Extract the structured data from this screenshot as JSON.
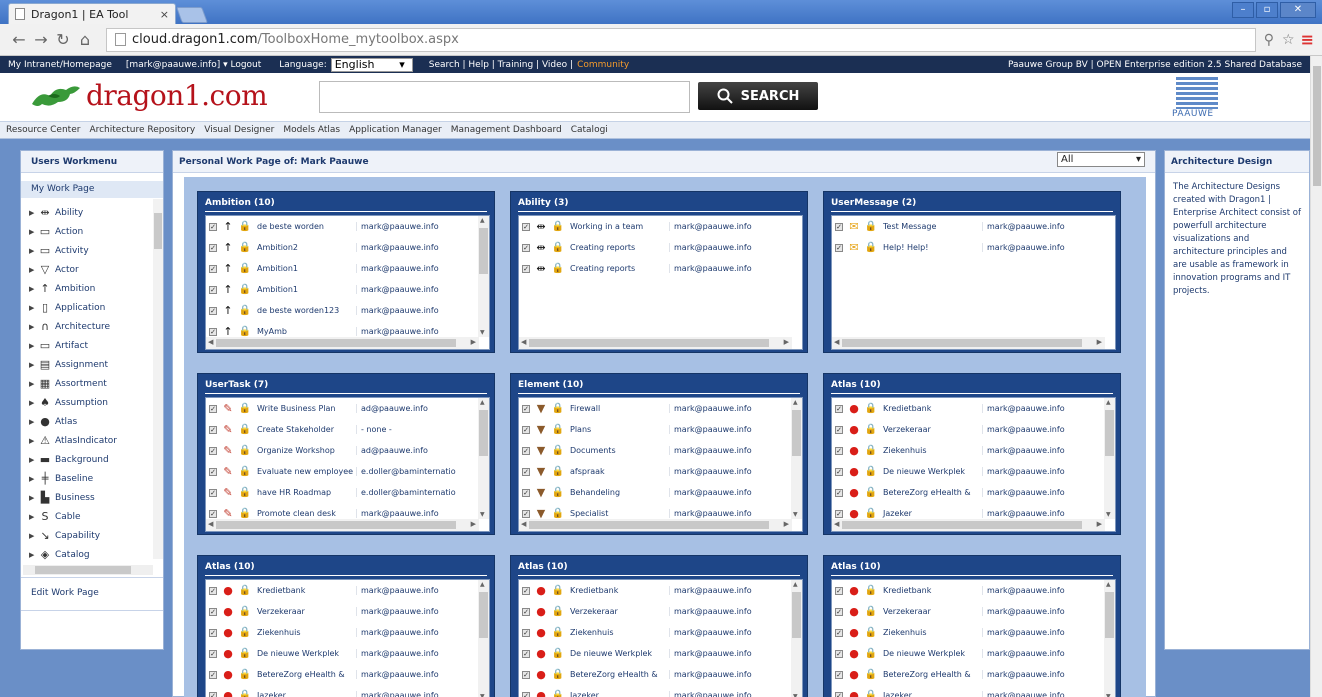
{
  "browser": {
    "tab_title": "Dragon1 | EA Tool",
    "tab_close": "×",
    "url_host": "cloud.dragon1.com",
    "url_path": "/ToolboxHome_mytoolbox.aspx"
  },
  "topbar": {
    "intranet": "My Intranet/Homepage",
    "user": "[mark@paauwe.info] ▾ Logout",
    "language_label": "Language:",
    "language_value": "English",
    "links": "Search | Help | Training | Video |",
    "community": "Community",
    "right": "Paauwe Group BV | OPEN   Enterprise edition   2.5   Shared Database"
  },
  "header": {
    "logo_text": "dragon1.com",
    "search_label": "SEARCH",
    "partner_logo": "PAAUWE"
  },
  "menu": [
    "Resource Center",
    "Architecture Repository",
    "Visual Designer",
    "Models Atlas",
    "Application Manager",
    "Management Dashboard",
    "Catalogi"
  ],
  "left": {
    "title": "Users Workmenu",
    "my_work_page": "My Work Page",
    "items": [
      {
        "label": "Ability",
        "icon": "ability-icon",
        "glyph": "⇹"
      },
      {
        "label": "Action",
        "icon": "action-icon",
        "glyph": "▭"
      },
      {
        "label": "Activity",
        "icon": "activity-icon",
        "glyph": "▭"
      },
      {
        "label": "Actor",
        "icon": "actor-icon",
        "glyph": "▽"
      },
      {
        "label": "Ambition",
        "icon": "ambition-icon",
        "glyph": "↑"
      },
      {
        "label": "Application",
        "icon": "application-icon",
        "glyph": "▯"
      },
      {
        "label": "Architecture",
        "icon": "architecture-icon",
        "glyph": "∩"
      },
      {
        "label": "Artifact",
        "icon": "artifact-icon",
        "glyph": "▭"
      },
      {
        "label": "Assignment",
        "icon": "assignment-icon",
        "glyph": "▤"
      },
      {
        "label": "Assortment",
        "icon": "assortment-icon",
        "glyph": "▦"
      },
      {
        "label": "Assumption",
        "icon": "assumption-icon",
        "glyph": "♠"
      },
      {
        "label": "Atlas",
        "icon": "atlas-icon",
        "glyph": "●"
      },
      {
        "label": "AtlasIndicator",
        "icon": "atlas-indicator-icon",
        "glyph": "⚠"
      },
      {
        "label": "Background",
        "icon": "background-icon",
        "glyph": "▬"
      },
      {
        "label": "Baseline",
        "icon": "baseline-icon",
        "glyph": "╪"
      },
      {
        "label": "Business",
        "icon": "business-icon",
        "glyph": "▙"
      },
      {
        "label": "Cable",
        "icon": "cable-icon",
        "glyph": "S"
      },
      {
        "label": "Capability",
        "icon": "capability-icon",
        "glyph": "↘"
      },
      {
        "label": "Catalog",
        "icon": "catalog-icon",
        "glyph": "◈"
      }
    ],
    "edit_work_page": "Edit Work Page"
  },
  "main": {
    "title": "Personal Work Page of: Mark Paauwe",
    "filter_value": "All",
    "boxes": [
      {
        "title": "Ambition (10)",
        "type_icon": "↑",
        "type_color": "#111",
        "rows": [
          {
            "name": "de beste worden",
            "owner": "mark@paauwe.info"
          },
          {
            "name": "Ambition2",
            "owner": "mark@paauwe.info"
          },
          {
            "name": "Ambition1",
            "owner": "mark@paauwe.info"
          },
          {
            "name": "Ambition1",
            "owner": "mark@paauwe.info"
          },
          {
            "name": "de beste worden123",
            "owner": "mark@paauwe.info"
          },
          {
            "name": "MyAmb",
            "owner": "mark@paauwe.info"
          }
        ]
      },
      {
        "title": "Ability (3)",
        "type_icon": "⇹",
        "type_color": "#111",
        "rows": [
          {
            "name": "Working in a team",
            "owner": "mark@paauwe.info"
          },
          {
            "name": "Creating reports",
            "owner": "mark@paauwe.info"
          },
          {
            "name": "Creating reports",
            "owner": "mark@paauwe.info"
          }
        ]
      },
      {
        "title": "UserMessage (2)",
        "type_icon": "✉",
        "type_color": "#e6a417",
        "rows": [
          {
            "name": "Test Message",
            "owner": "mark@paauwe.info"
          },
          {
            "name": "Help! Help!",
            "owner": "mark@paauwe.info"
          }
        ]
      },
      {
        "title": "UserTask (7)",
        "type_icon": "✎",
        "type_color": "#c0392b",
        "rows": [
          {
            "name": "Write Business Plan",
            "owner": "ad@paauwe.info"
          },
          {
            "name": "Create Stakeholder",
            "owner": "- none -"
          },
          {
            "name": "Organize Workshop",
            "owner": "ad@paauwe.info"
          },
          {
            "name": "Evaluate new employee",
            "owner": "e.doller@baminternatio"
          },
          {
            "name": "have HR Roadmap",
            "owner": "e.doller@baminternatio"
          },
          {
            "name": "Promote clean desk",
            "owner": "mark@paauwe.info"
          }
        ]
      },
      {
        "title": "Element (10)",
        "type_icon": "▼",
        "type_color": "#8b5a2b",
        "rows": [
          {
            "name": "Firewall",
            "owner": "mark@paauwe.info"
          },
          {
            "name": "Plans",
            "owner": "mark@paauwe.info"
          },
          {
            "name": "Documents",
            "owner": "mark@paauwe.info"
          },
          {
            "name": "afspraak",
            "owner": "mark@paauwe.info"
          },
          {
            "name": "Behandeling",
            "owner": "mark@paauwe.info"
          },
          {
            "name": "Specialist",
            "owner": "mark@paauwe.info"
          }
        ]
      },
      {
        "title": "Atlas (10)",
        "type_icon": "●",
        "type_color": "#d91e18",
        "rows": [
          {
            "name": "Kredietbank",
            "owner": "mark@paauwe.info"
          },
          {
            "name": "Verzekeraar",
            "owner": "mark@paauwe.info"
          },
          {
            "name": "Ziekenhuis",
            "owner": "mark@paauwe.info"
          },
          {
            "name": "De nieuwe Werkplek",
            "owner": "mark@paauwe.info"
          },
          {
            "name": "BetereZorg eHealth &",
            "owner": "mark@paauwe.info"
          },
          {
            "name": "Jazeker",
            "owner": "mark@paauwe.info"
          }
        ]
      },
      {
        "title": "Atlas (10)",
        "type_icon": "●",
        "type_color": "#d91e18",
        "rows": [
          {
            "name": "Kredietbank",
            "owner": "mark@paauwe.info"
          },
          {
            "name": "Verzekeraar",
            "owner": "mark@paauwe.info"
          },
          {
            "name": "Ziekenhuis",
            "owner": "mark@paauwe.info"
          },
          {
            "name": "De nieuwe Werkplek",
            "owner": "mark@paauwe.info"
          },
          {
            "name": "BetereZorg eHealth &",
            "owner": "mark@paauwe.info"
          },
          {
            "name": "Jazeker",
            "owner": "mark@paauwe.info"
          }
        ]
      },
      {
        "title": "Atlas (10)",
        "type_icon": "●",
        "type_color": "#d91e18",
        "rows": [
          {
            "name": "Kredietbank",
            "owner": "mark@paauwe.info"
          },
          {
            "name": "Verzekeraar",
            "owner": "mark@paauwe.info"
          },
          {
            "name": "Ziekenhuis",
            "owner": "mark@paauwe.info"
          },
          {
            "name": "De nieuwe Werkplek",
            "owner": "mark@paauwe.info"
          },
          {
            "name": "BetereZorg eHealth &",
            "owner": "mark@paauwe.info"
          },
          {
            "name": "Jazeker",
            "owner": "mark@paauwe.info"
          }
        ]
      },
      {
        "title": "Atlas (10)",
        "type_icon": "●",
        "type_color": "#d91e18",
        "rows": [
          {
            "name": "Kredietbank",
            "owner": "mark@paauwe.info"
          },
          {
            "name": "Verzekeraar",
            "owner": "mark@paauwe.info"
          },
          {
            "name": "Ziekenhuis",
            "owner": "mark@paauwe.info"
          },
          {
            "name": "De nieuwe Werkplek",
            "owner": "mark@paauwe.info"
          },
          {
            "name": "BetereZorg eHealth &",
            "owner": "mark@paauwe.info"
          },
          {
            "name": "Jazeker",
            "owner": "mark@paauwe.info"
          }
        ]
      }
    ]
  },
  "right": {
    "title": "Architecture Design",
    "description": "The Architecture Designs created with Dragon1 | Enterprise Architect consist of powerfull architecture visualizations and architecture principles and are usable as framework in innovation programs and IT projects."
  }
}
